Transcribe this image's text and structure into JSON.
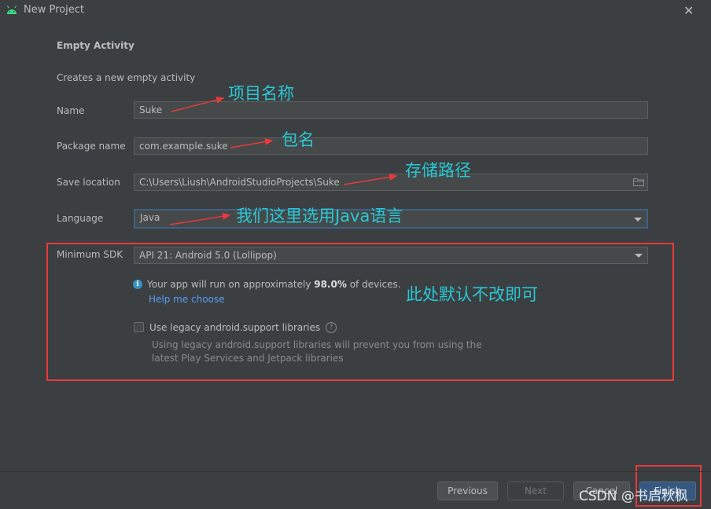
{
  "window": {
    "title": "New Project",
    "close_glyph": "✕",
    "icon": "android-icon"
  },
  "section": {
    "title": "Empty Activity",
    "description": "Creates a new empty activity"
  },
  "fields": {
    "name": {
      "label": "Name",
      "value": "Suke"
    },
    "package": {
      "label": "Package name",
      "value": "com.example.suke"
    },
    "save_location": {
      "label": "Save location",
      "value": "C:\\Users\\Liush\\AndroidStudioProjects\\Suke"
    },
    "language": {
      "label": "Language",
      "value": "Java"
    },
    "min_sdk": {
      "label": "Minimum SDK",
      "value": "API 21: Android 5.0 (Lollipop)"
    }
  },
  "info": {
    "icon_glyph": "i",
    "text_before": "Your app will run on approximately ",
    "percent": "98.0%",
    "text_after": " of devices.",
    "link": "Help me choose"
  },
  "legacy": {
    "label": "Use legacy android.support libraries",
    "help_glyph": "?",
    "description": "Using legacy android.support libraries will prevent you from using the latest Play Services and Jetpack libraries"
  },
  "annotations": {
    "name": "项目名称",
    "package": "包名",
    "save_location": "存储路径",
    "language": "我们这里选用Java语言",
    "sdk": "此处默认不改即可"
  },
  "buttons": {
    "previous": "Previous",
    "next": "Next",
    "cancel": "Cancel",
    "finish": "Finish"
  },
  "watermark": "CSDN @书启秋枫",
  "colors": {
    "annotation": "#29c8d6",
    "highlight_box": "#e8393d",
    "arrow": "#e8393d",
    "link": "#589df6"
  }
}
